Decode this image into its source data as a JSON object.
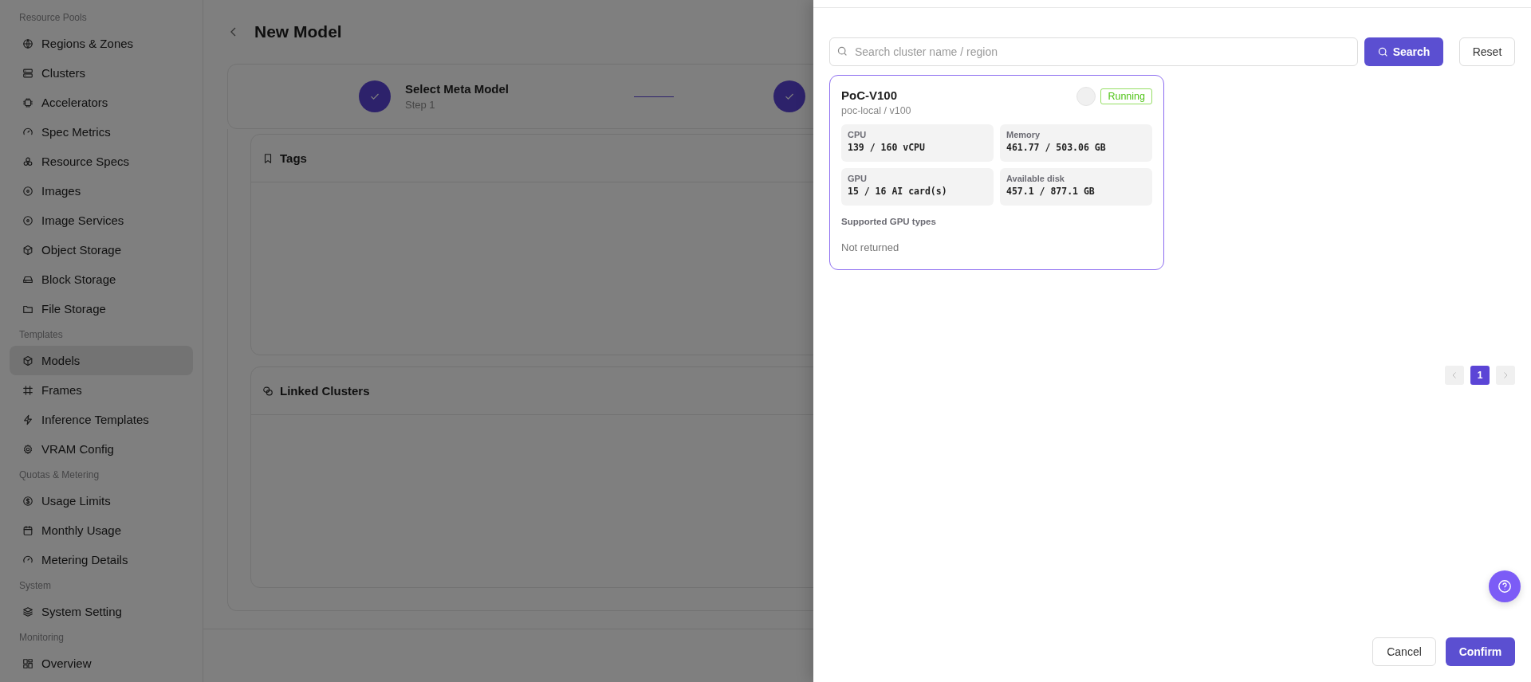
{
  "sidebar": {
    "sections": [
      {
        "title": "Resource Pools",
        "items": [
          {
            "label": "Regions & Zones",
            "kind": "globe",
            "selected": false
          },
          {
            "label": "Clusters",
            "kind": "server",
            "selected": false
          },
          {
            "label": "Accelerators",
            "kind": "chip",
            "selected": false
          },
          {
            "label": "Spec Metrics",
            "kind": "gauge",
            "selected": false
          },
          {
            "label": "Resource Specs",
            "kind": "nodes",
            "selected": false
          },
          {
            "label": "Images",
            "kind": "disc",
            "selected": false
          },
          {
            "label": "Image Services",
            "kind": "disc",
            "selected": false
          },
          {
            "label": "Object Storage",
            "kind": "cube",
            "selected": false
          },
          {
            "label": "Block Storage",
            "kind": "drive",
            "selected": false
          },
          {
            "label": "File Storage",
            "kind": "folder",
            "selected": false
          }
        ]
      },
      {
        "title": "Templates",
        "items": [
          {
            "label": "Models",
            "kind": "cube",
            "selected": true
          },
          {
            "label": "Frames",
            "kind": "hash",
            "selected": false
          },
          {
            "label": "Inference Templates",
            "kind": "bolt",
            "selected": false
          },
          {
            "label": "VRAM Config",
            "kind": "gear",
            "selected": false
          }
        ]
      },
      {
        "title": "Quotas & Metering",
        "items": [
          {
            "label": "Usage Limits",
            "kind": "dollar",
            "selected": false
          },
          {
            "label": "Monthly Usage",
            "kind": "calendar",
            "selected": false
          },
          {
            "label": "Metering Details",
            "kind": "gauge",
            "selected": false
          }
        ]
      },
      {
        "title": "System",
        "items": [
          {
            "label": "System Setting",
            "kind": "layers",
            "selected": false
          }
        ]
      },
      {
        "title": "Monitoring",
        "items": [
          {
            "label": "Overview",
            "kind": "grid",
            "selected": false
          }
        ]
      }
    ]
  },
  "page": {
    "title": "New Model",
    "steps": [
      {
        "title": "Select Meta Model",
        "subtitle": "Step 1",
        "done": true
      },
      {
        "done": true
      }
    ],
    "panels": [
      {
        "title": "Tags",
        "kind": "bookmark"
      },
      {
        "title": "Linked Clusters",
        "kind": "link"
      }
    ]
  },
  "drawer": {
    "search": {
      "placeholder": "Search cluster name / region"
    },
    "search_button": "Search",
    "reset_button": "Reset",
    "clusters": [
      {
        "name": "PoC-V100",
        "path": "poc-local / v100",
        "selected": true,
        "status": {
          "label": "Running",
          "kind": "success"
        },
        "metrics": [
          {
            "label": "CPU",
            "value": "139 / 160 vCPU"
          },
          {
            "label": "Memory",
            "value": "461.77 / 503.06 GB"
          },
          {
            "label": "GPU",
            "value": "15 / 16 AI card(s)"
          },
          {
            "label": "Available disk",
            "value": "457.1 / 877.1 GB"
          }
        ],
        "gpu_types_label": "Supported GPU types",
        "gpu_types_text": "Not returned"
      }
    ],
    "pagination": {
      "pages": [
        {
          "label": "1",
          "selected": true
        }
      ]
    },
    "buttons": {
      "cancel": "Cancel",
      "confirm": "Confirm"
    }
  }
}
